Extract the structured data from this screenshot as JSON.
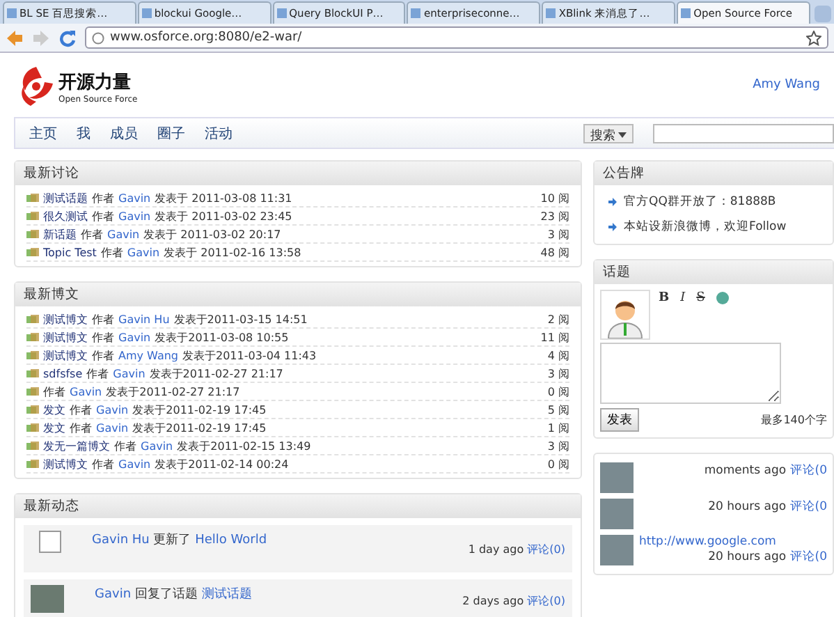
{
  "browser": {
    "tabs": [
      {
        "label": "BL SE 百思搜索…",
        "selected": false
      },
      {
        "label": "blockui  Google…",
        "selected": false
      },
      {
        "label": "Query BlockUI P…",
        "selected": false
      },
      {
        "label": "enterpriseconne…",
        "selected": false
      },
      {
        "label": "XBlink 来消息了…",
        "selected": false
      },
      {
        "label": "Open Source Force",
        "selected": true
      }
    ],
    "url": "www.osforce.org:8080/e2-war/"
  },
  "header": {
    "logo_text": "开源力量",
    "logo_subtext": "Open Source Force",
    "user": "Amy Wang"
  },
  "nav": {
    "items": [
      {
        "label": "主页",
        "selected": false
      },
      {
        "label": "我",
        "selected": false
      },
      {
        "label": "成员",
        "selected": false
      },
      {
        "label": "圈子",
        "selected": false
      },
      {
        "label": "活动",
        "selected": false
      }
    ],
    "search_scope": "搜索"
  },
  "discussions": {
    "title": "最新讨论",
    "rows": [
      {
        "title": "测试话题",
        "by": "作者",
        "author": "Gavin",
        "posted": "发表于 2011-03-08 11:31",
        "count": "10 阅"
      },
      {
        "title": "很久测试",
        "by": "作者",
        "author": "Gavin",
        "posted": "发表于 2011-03-02 23:45",
        "count": "23 阅"
      },
      {
        "title": "新话题",
        "by": "作者",
        "author": "Gavin",
        "posted": "发表于 2011-03-02 20:17",
        "count": "3 阅"
      },
      {
        "title": "Topic Test",
        "by": "作者",
        "author": "Gavin",
        "posted": "发表于 2011-02-16 13:58",
        "count": "48 阅"
      }
    ]
  },
  "blogs": {
    "title": "最新博文",
    "rows": [
      {
        "title": "测试博文",
        "by": "作者",
        "author": "Gavin Hu",
        "posted": "发表于2011-03-15 14:51",
        "count": "2 阅"
      },
      {
        "title": "测试博文",
        "by": "作者",
        "author": "Gavin",
        "posted": "发表于2011-03-08 10:55",
        "count": "11 阅"
      },
      {
        "title": "测试博文",
        "by": "作者",
        "author": "Amy Wang",
        "posted": "发表于2011-03-04 11:43",
        "count": "4 阅"
      },
      {
        "title": "sdfsfse",
        "by": "作者",
        "author": "Gavin",
        "posted": "发表于2011-02-27 21:17",
        "count": "3 阅"
      },
      {
        "by": "作者",
        "author": "Gavin",
        "posted": "发表于2011-02-27 21:17",
        "count": "0 阅"
      },
      {
        "title": "发文",
        "by": "作者",
        "author": "Gavin",
        "posted": "发表于2011-02-19 17:45",
        "count": "5 阅"
      },
      {
        "title": "发文",
        "by": "作者",
        "author": "Gavin",
        "posted": "发表于2011-02-19 17:45",
        "count": "1 阅"
      },
      {
        "title": "发无一篇博文",
        "by": "作者",
        "author": "Gavin",
        "posted": "发表于2011-02-15 13:49",
        "count": "3 阅"
      },
      {
        "title": "测试博文",
        "by": "作者",
        "author": "Gavin",
        "posted": "发表于2011-02-14 00:24",
        "count": "0 阅"
      }
    ]
  },
  "activity": {
    "title": "最新动态",
    "items": [
      {
        "kind": "icon",
        "actor": "Gavin Hu",
        "action": "更新了",
        "target": "Hello World",
        "time": "1 day ago",
        "comments": "评论(0)"
      },
      {
        "kind": "photo",
        "actor": "Gavin",
        "action": "回复了话题",
        "target": "测试话题",
        "time": "2 days ago",
        "comments": "评论(0)"
      }
    ]
  },
  "notices": {
    "title": "公告牌",
    "items": [
      {
        "text": "官方QQ群开放了：81888B"
      },
      {
        "text": "本站设新浪微博，欢迎Follow"
      }
    ]
  },
  "topic": {
    "title": "话题",
    "tools": [
      "B",
      "I",
      "S"
    ],
    "submit": "发表",
    "hint": "最多140个字"
  },
  "feed": {
    "items": [
      {
        "time": "moments ago",
        "comments": "评论(0"
      },
      {
        "time": "20 hours ago",
        "comments": "评论(0"
      },
      {
        "text": "http://www.google.com",
        "time": "20 hours ago",
        "comments": "评论(0"
      }
    ]
  }
}
